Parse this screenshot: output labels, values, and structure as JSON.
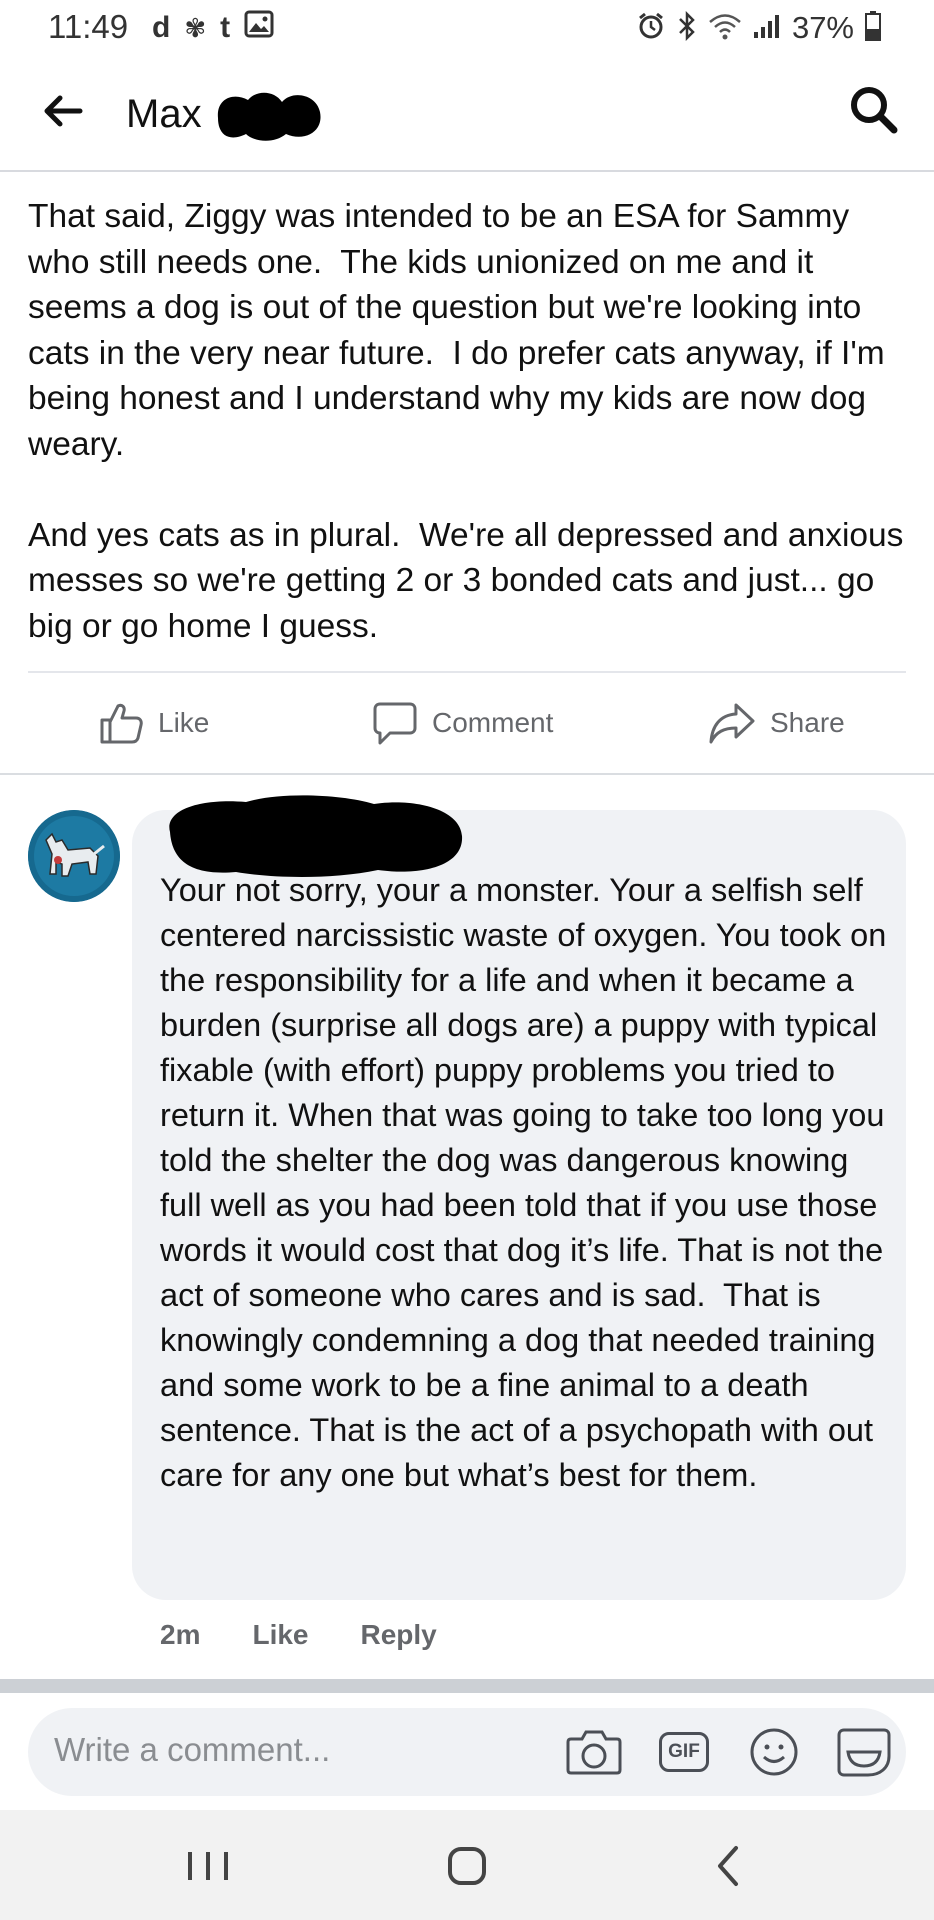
{
  "status_bar": {
    "time": "11:49",
    "left_icons": [
      "d",
      "✾",
      "t"
    ],
    "battery_pct": "37%"
  },
  "header": {
    "title": "Max"
  },
  "post": {
    "text": "That said, Ziggy was intended to be an ESA for Sammy who still needs one.  The kids unionized on me and it seems a dog is out of the question but we're looking into cats in the very near future.  I do prefer cats anyway, if I'm being honest and I understand why my kids are now dog weary.\n\nAnd yes cats as in plural.  We're all depressed and anxious messes so we're getting 2 or 3 bonded cats and just... go big or go home I guess."
  },
  "actions": {
    "like": "Like",
    "comment": "Comment",
    "share": "Share"
  },
  "comment": {
    "text": "Your not sorry, your a monster. Your a selfish self centered narcissistic waste of oxygen. You took on the responsibility for a life and when it became a burden (surprise all dogs are) a puppy with typical fixable (with effort) puppy problems you tried to return it. When that was going to take too long you told the shelter the dog was dangerous knowing full well as you had been told that if you use those words it would cost that dog it’s life. That is not the act of someone who cares and is sad.  That is knowingly condemning a dog that needed training and some work to be a fine animal to a death sentence. That is the act of a psychopath with out care for any one but what’s best for them.",
    "time": "2m",
    "like": "Like",
    "reply": "Reply"
  },
  "composer": {
    "placeholder": "Write a comment...",
    "gif_label": "GIF"
  },
  "colors": {
    "bubble": "#f0f2f5",
    "secondary_text": "#65676b",
    "redaction": "#000000"
  }
}
